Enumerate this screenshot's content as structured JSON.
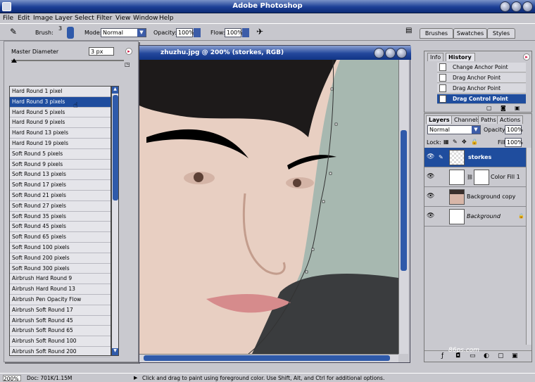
{
  "app": {
    "title": "Adobe Photoshop"
  },
  "menu": [
    "File",
    "Edit",
    "Image",
    "Layer",
    "Select",
    "Filter",
    "View",
    "Window",
    "Help"
  ],
  "options": {
    "brush_label": "Brush:",
    "brush_size": "3",
    "mode_label": "Mode:",
    "mode_value": "Normal",
    "opacity_label": "Opacity:",
    "opacity_value": "100%",
    "flow_label": "Flow:",
    "flow_value": "100%"
  },
  "palette_well": [
    "Brushes",
    "Swatches",
    "Styles"
  ],
  "brush_panel": {
    "diameter_label": "Master Diameter",
    "diameter_value": "3 px",
    "items": [
      "Hard Round 1 pixel",
      "Hard Round 3 pixels",
      "Hard Round 5 pixels",
      "Hard Round 9 pixels",
      "Hard Round 13 pixels",
      "Hard Round 19 pixels",
      "Soft Round 5 pixels",
      "Soft Round 9 pixels",
      "Soft Round 13 pixels",
      "Soft Round 17 pixels",
      "Soft Round 21 pixels",
      "Soft Round 27 pixels",
      "Soft Round 35 pixels",
      "Soft Round 45 pixels",
      "Soft Round 65 pixels",
      "Soft Round 100 pixels",
      "Soft Round 200 pixels",
      "Soft Round 300 pixels",
      "Airbrush Hard Round 9",
      "Airbrush Hard Round 13",
      "Airbrush Pen Opacity Flow",
      "Airbrush Soft Round 17",
      "Airbrush Soft Round 45",
      "Airbrush Soft Round 65",
      "Airbrush Soft Round 100",
      "Airbrush Soft Round 200"
    ],
    "selected_index": 1
  },
  "document": {
    "title": "zhuzhu.jpg @ 200% (storkes, RGB)"
  },
  "history": {
    "tabs": [
      "Info",
      "History"
    ],
    "items": [
      "Change Anchor Point",
      "Drag Anchor Point",
      "Drag Anchor Point",
      "Drag Control Point"
    ],
    "active_index": 3
  },
  "layers": {
    "tabs": [
      "Layers",
      "Channels",
      "Paths",
      "Actions"
    ],
    "blend_mode": "Normal",
    "opacity_label": "Opacity:",
    "opacity_value": "100%",
    "lock_label": "Lock:",
    "fill_label": "Fill:",
    "fill_value": "100%",
    "items": [
      {
        "name": "storkes"
      },
      {
        "name": "Color Fill 1"
      },
      {
        "name": "Background copy"
      },
      {
        "name": "Background"
      }
    ],
    "active_index": 0
  },
  "status": {
    "zoom": "200%",
    "doc": "Doc: 701K/1.15M",
    "hint": "Click and drag to paint using foreground color.  Use Shift, Alt, and Ctrl for additional options."
  },
  "watermark": "86ps.com"
}
